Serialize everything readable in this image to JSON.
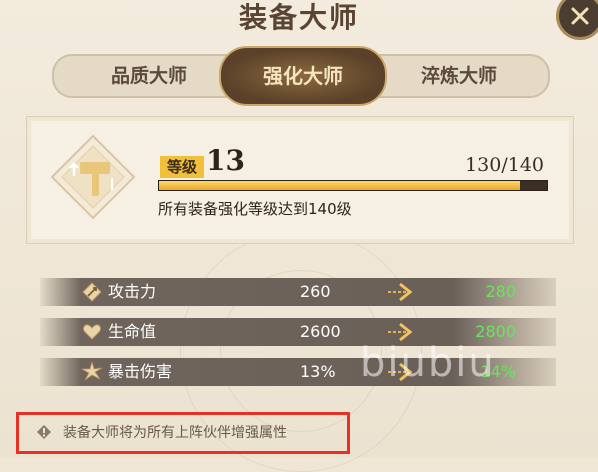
{
  "window": {
    "title": "装备大师"
  },
  "tabs": [
    {
      "label": "品质大师",
      "active": false
    },
    {
      "label": "强化大师",
      "active": true
    },
    {
      "label": "淬炼大师",
      "active": false
    }
  ],
  "level_panel": {
    "label": "等级",
    "value": "13",
    "progress_text": "130/140",
    "progress_fraction": 0.93,
    "description": "所有装备强化等级达到140级"
  },
  "stats": [
    {
      "icon": "attack-icon",
      "name": "攻击力",
      "current": "260",
      "next": "280"
    },
    {
      "icon": "heart-icon",
      "name": "生命值",
      "current": "2600",
      "next": "2800"
    },
    {
      "icon": "crit-icon",
      "name": "暴击伤害",
      "current": "13%",
      "next": "14%"
    }
  ],
  "watermark": "biubiu",
  "note": {
    "text": "装备大师将为所有上阵伙伴增强属性"
  },
  "colors": {
    "accent_gold": "#f0c03a",
    "next_value_green": "#6ae55a",
    "highlight_red": "#e83027"
  }
}
